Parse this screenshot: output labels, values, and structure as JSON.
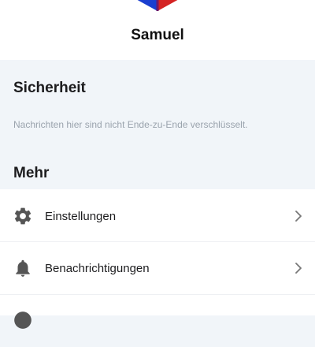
{
  "profile": {
    "name": "Samuel",
    "avatar_colors": [
      "#1a3fd0",
      "#d42323",
      "#6b1a6b"
    ]
  },
  "security": {
    "title": "Sicherheit",
    "note": "Nachrichten hier sind nicht Ende-zu-Ende verschlüsselt."
  },
  "more": {
    "title": "Mehr",
    "items": [
      {
        "label": "Einstellungen",
        "icon": "gear-icon"
      },
      {
        "label": "Benachrichtigungen",
        "icon": "bell-icon"
      },
      {
        "label": "",
        "icon": "help-icon"
      }
    ]
  },
  "colors": {
    "background": "#f1f5f9",
    "card": "#ffffff",
    "icon": "#555555",
    "muted_text": "#9aa3ad"
  }
}
